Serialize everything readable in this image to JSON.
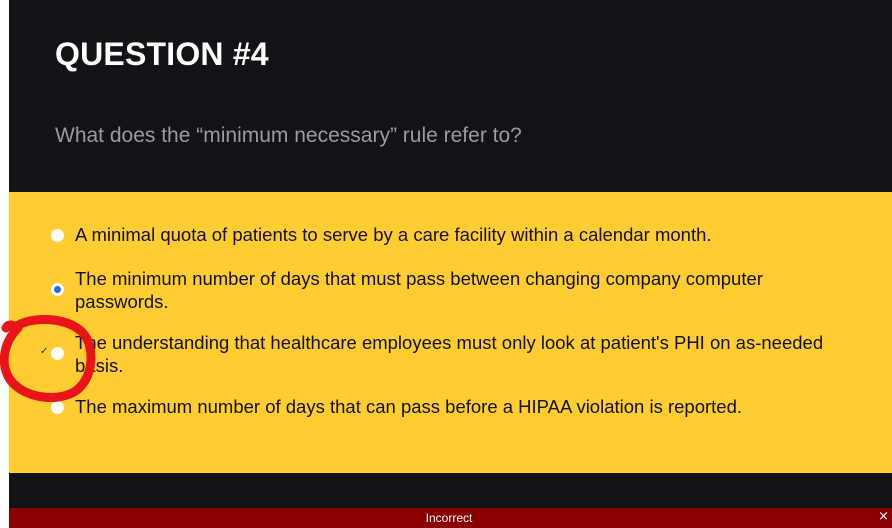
{
  "question": {
    "title": "QUESTION #4",
    "text": "What does the “minimum necessary” rule refer to?"
  },
  "options": [
    {
      "label": "A minimal quota of patients to serve by a care facility within a calendar month.",
      "selected": false,
      "marked_correct": false
    },
    {
      "label": "The minimum number of days that must pass between changing company computer passwords.",
      "selected": true,
      "marked_correct": false
    },
    {
      "label": "The understanding that healthcare employees must only look at patient's PHI on as-needed basis.",
      "selected": false,
      "marked_correct": true
    },
    {
      "label": "The maximum number of days that can pass before a HIPAA violation is reported.",
      "selected": false,
      "marked_correct": false
    }
  ],
  "check_glyph": "✓",
  "status": {
    "text": "Incorrect",
    "close_glyph": "×"
  },
  "colors": {
    "header_bg": "#121316",
    "answers_bg": "#ffcd32",
    "status_bg": "#8a0000",
    "selected_radio": "#1a6fd6",
    "annotation": "#e8141a"
  },
  "icons": {
    "check": "check-icon",
    "close": "close-icon",
    "annotation": "red-circle-annotation"
  }
}
